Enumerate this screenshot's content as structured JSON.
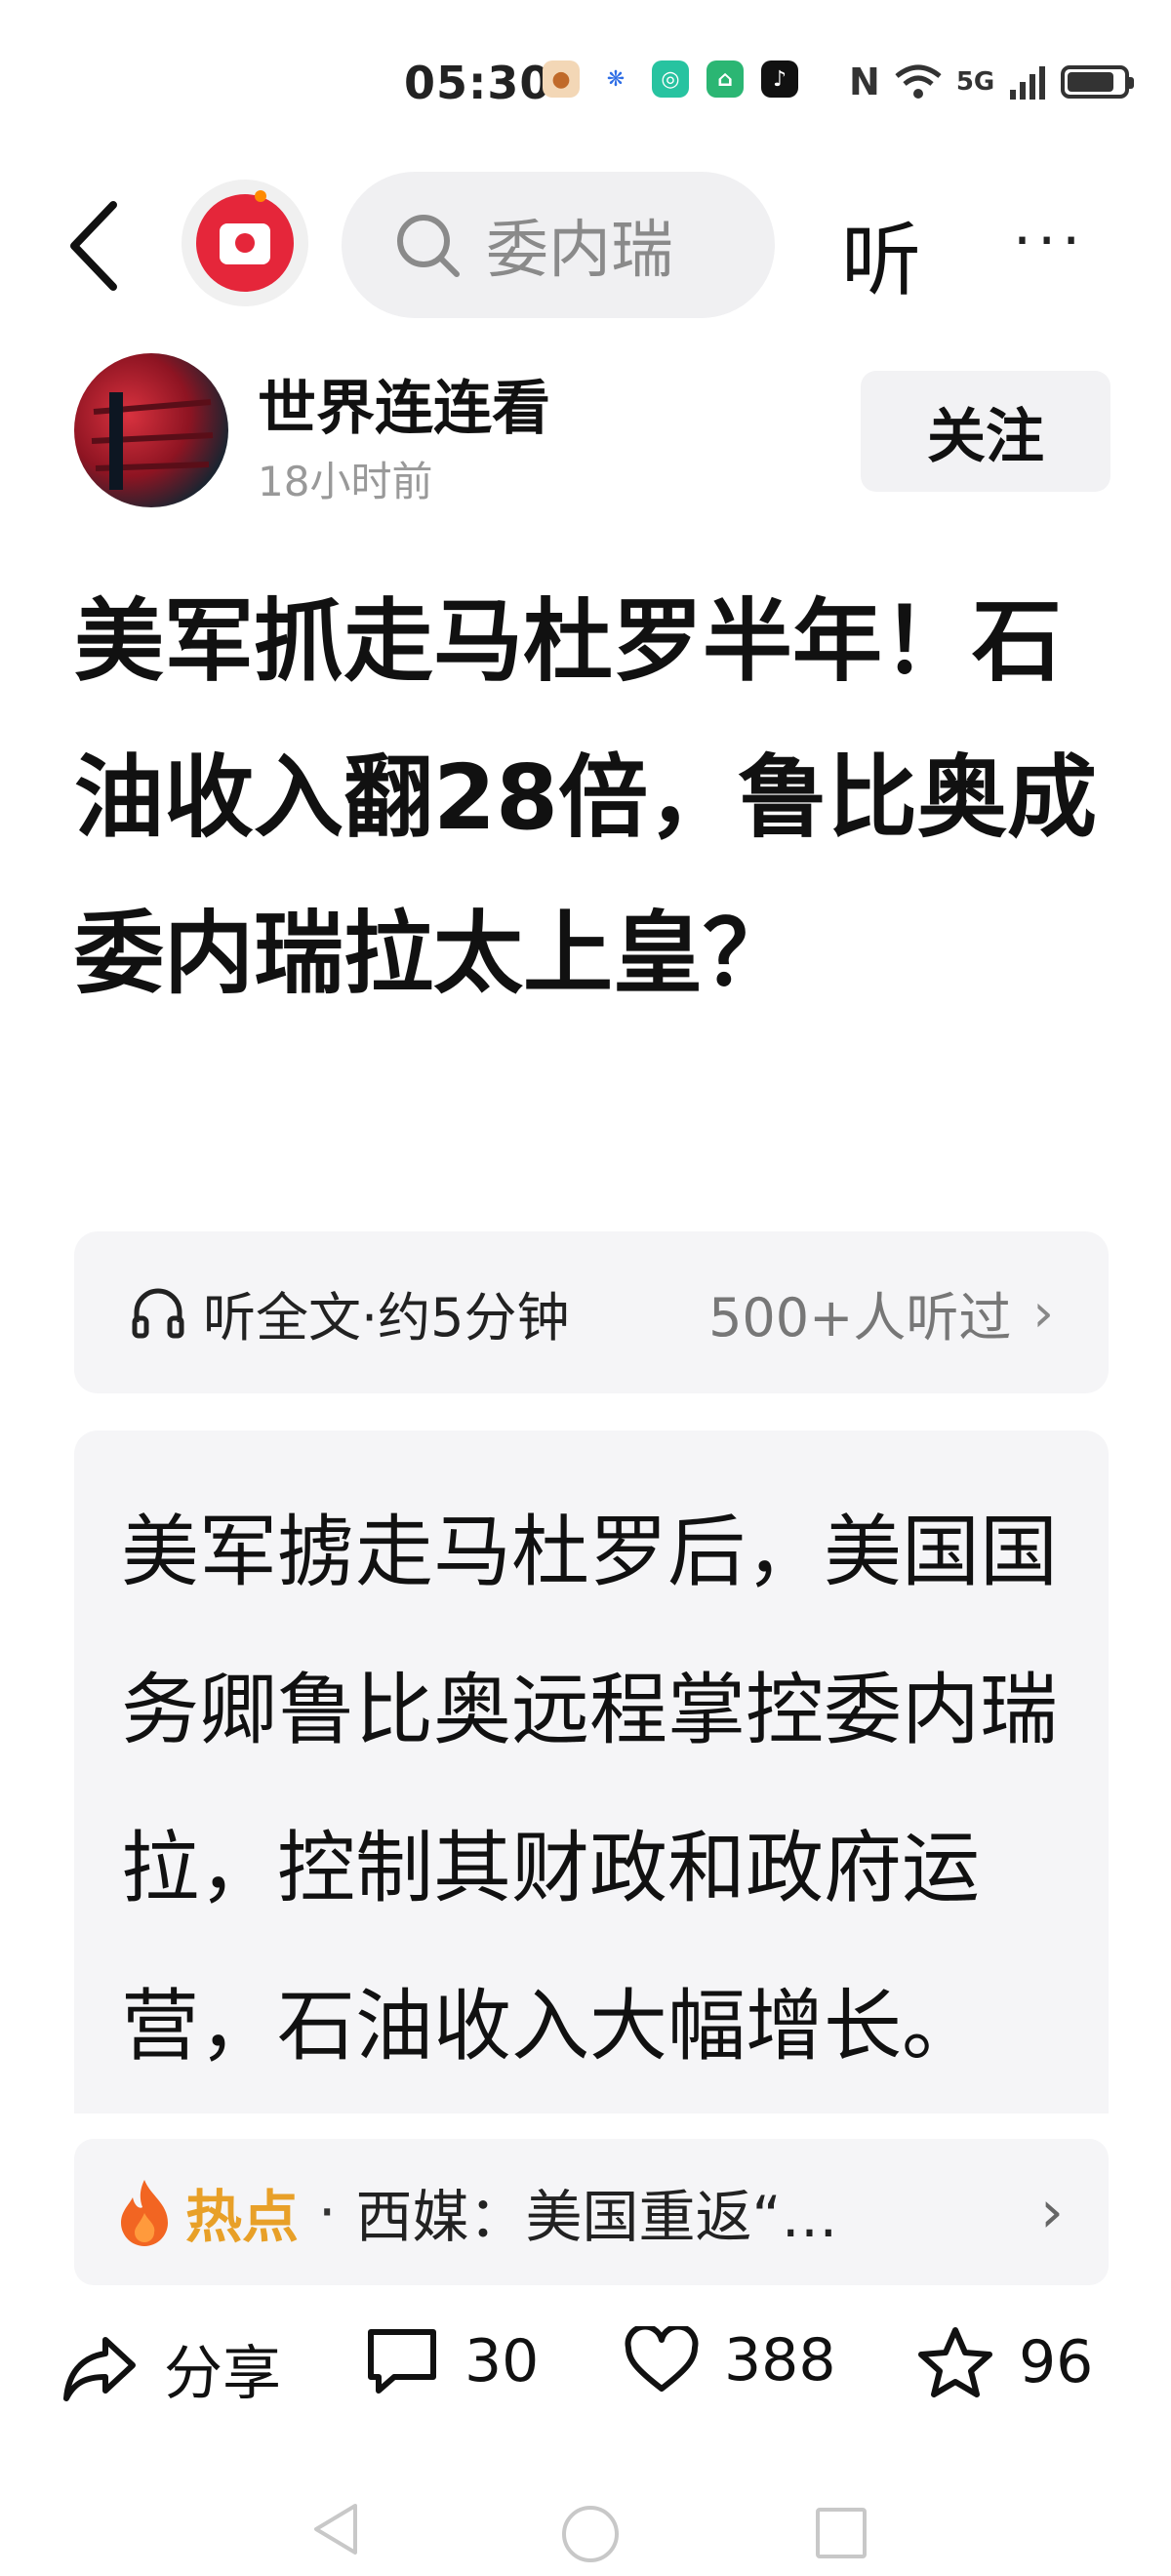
{
  "status_bar": {
    "time": "05:30",
    "network": "5G",
    "app_icons": [
      "cat-app-icon",
      "baidu-paw-icon",
      "camera-app-icon",
      "house-app-icon",
      "tiktok-icon"
    ],
    "system_icons": [
      "nfc-icon",
      "wifi-icon",
      "signal-icon",
      "battery-icon"
    ],
    "battery_level": 0.85
  },
  "nav": {
    "back_icon": "chevron-left-icon",
    "red_packet_icon": "red-packet-icon",
    "search_query": "委内瑞",
    "listen_label": "听",
    "more_label": "···"
  },
  "author": {
    "name": "世界连连看",
    "time": "18小时前",
    "follow_label": "关注"
  },
  "article": {
    "title": "美军抓走马杜罗半年！石油收入翻28倍，鲁比奥成委内瑞拉太上皇？"
  },
  "listen_bar": {
    "label": "听全文·约5分钟",
    "count": "500+人听过",
    "chevron": "›"
  },
  "summary": {
    "text": "美军掳走马杜罗后，美国国务卿鲁比奥远程掌控委内瑞拉，控制其财政和政府运营，石油收入大幅增长。"
  },
  "hot": {
    "label": "热点",
    "separator": "·",
    "text": "西媒：美国重返“…",
    "chevron": "›"
  },
  "actions": {
    "share": "分享",
    "comments": "30",
    "likes": "388",
    "favorites": "96"
  },
  "colors": {
    "accent_red": "#e5263a",
    "hot_orange": "#e8a028",
    "card_bg": "#f5f5f7"
  }
}
